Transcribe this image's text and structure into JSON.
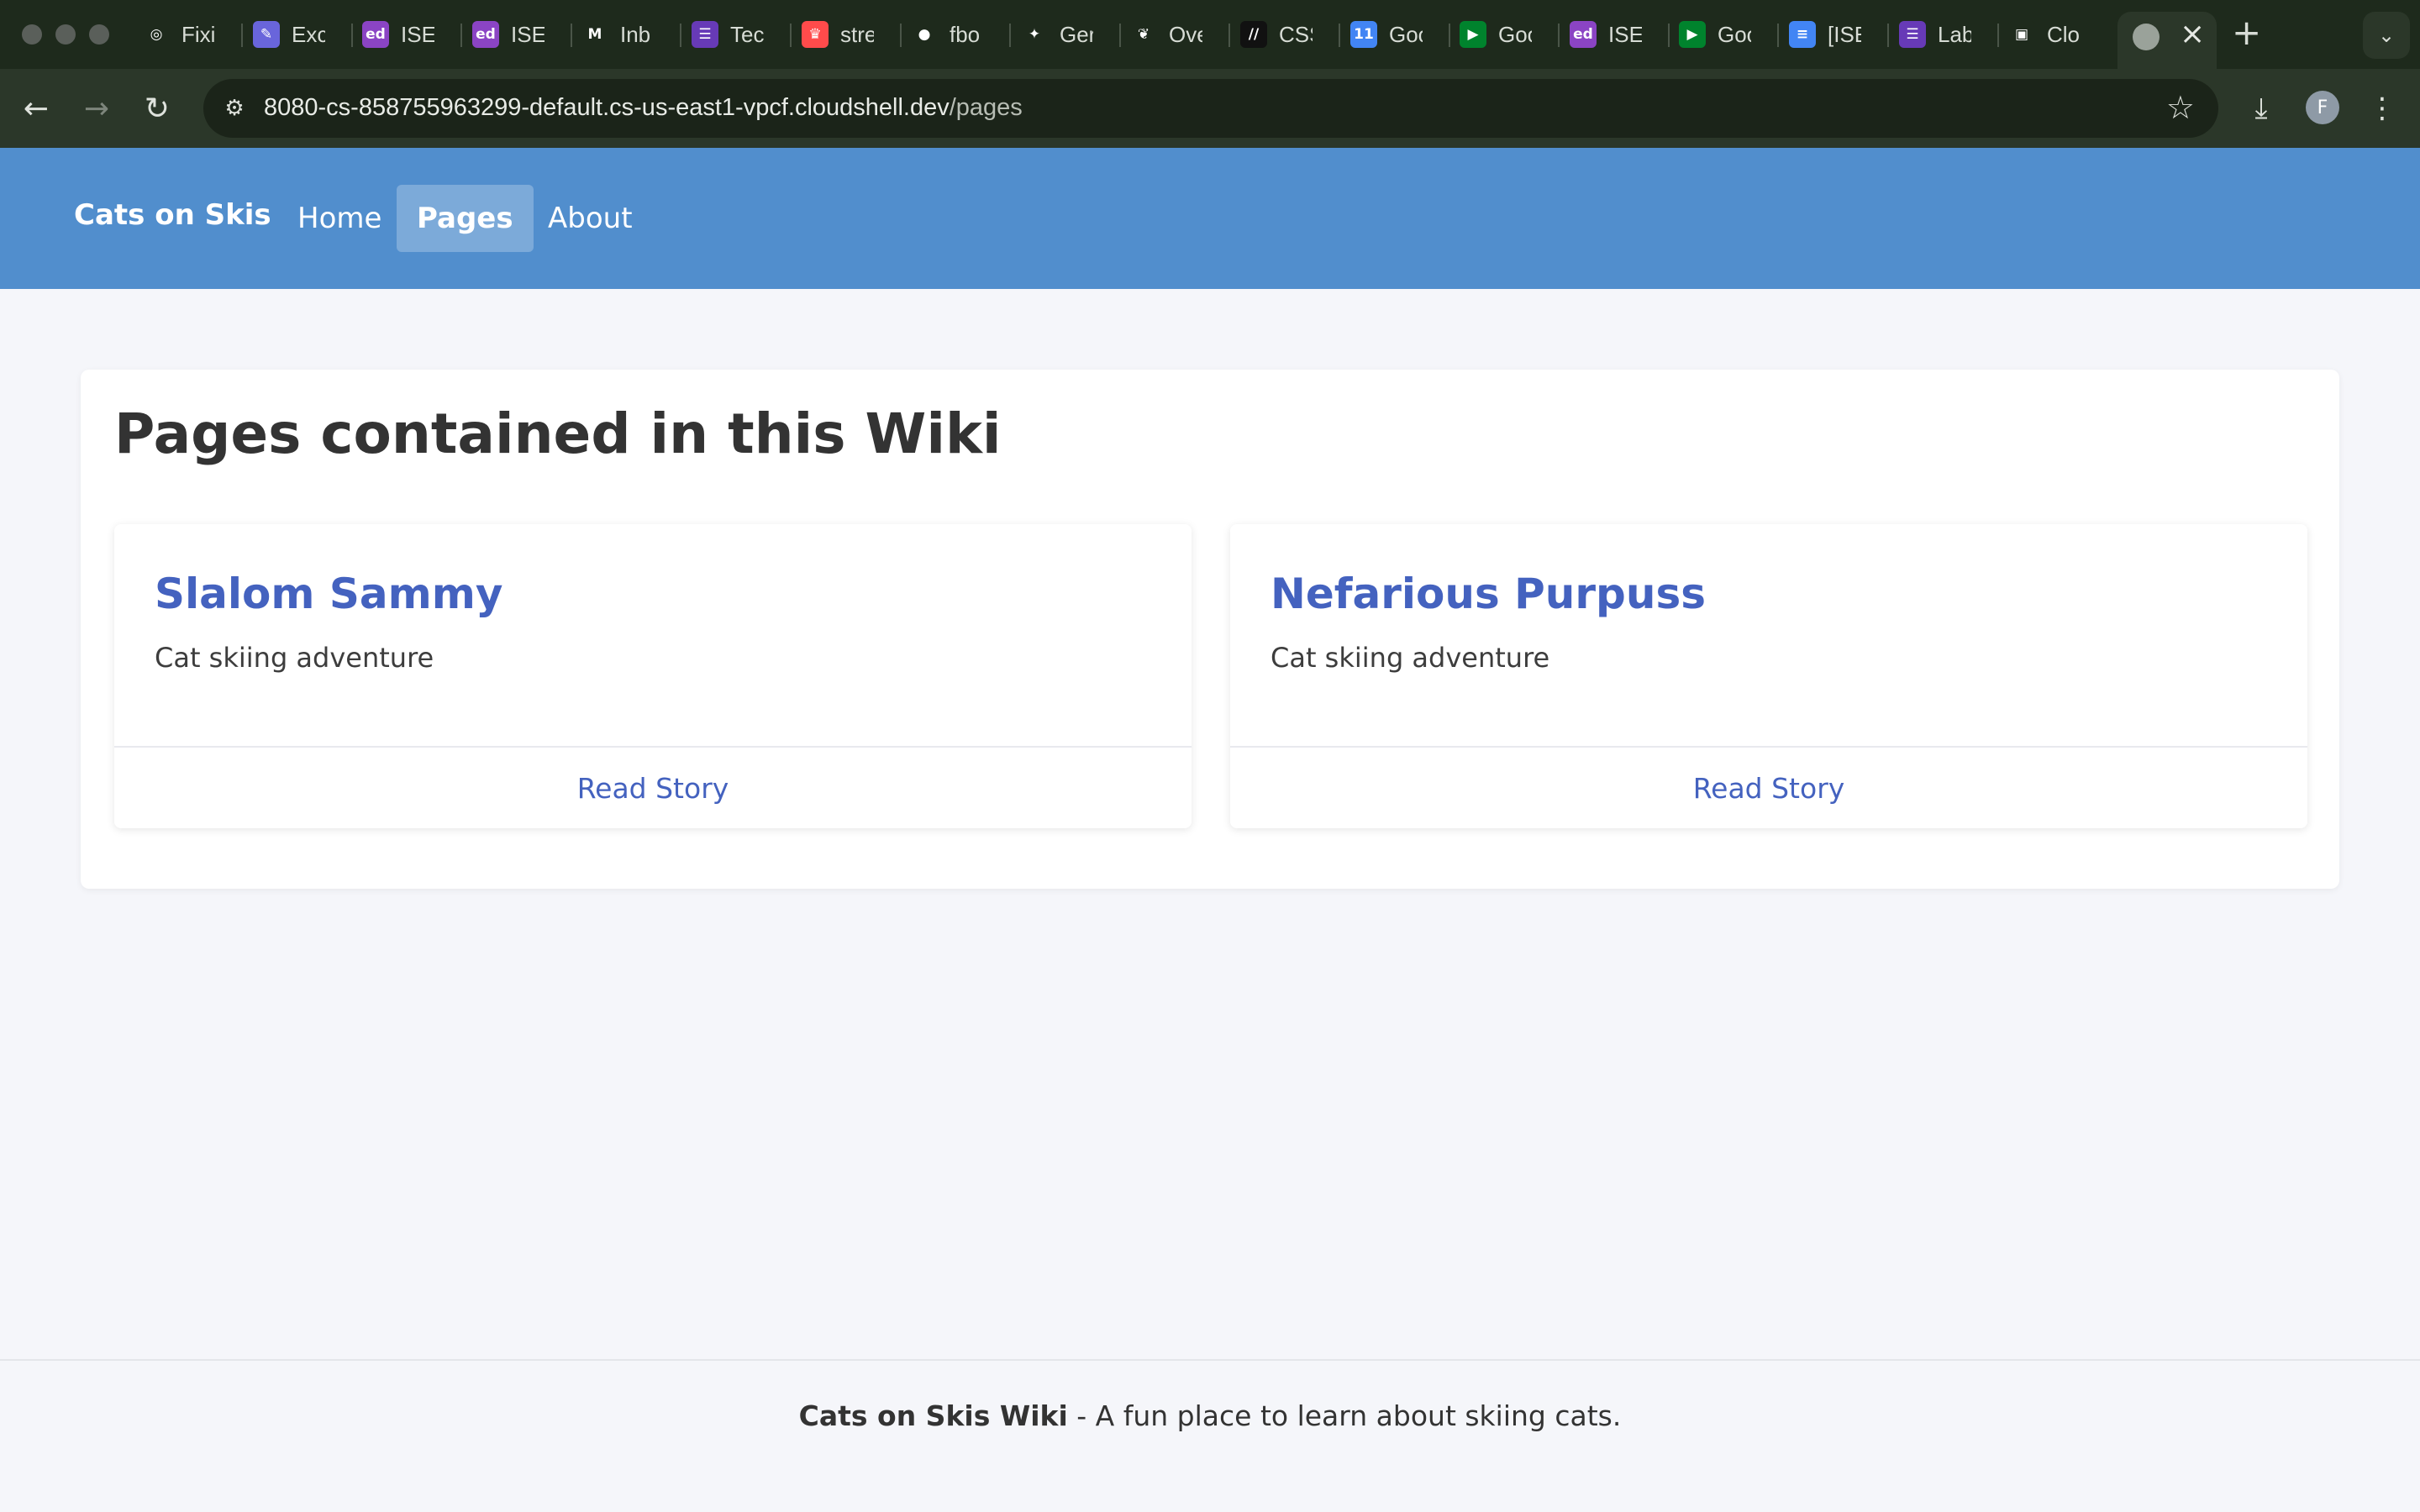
{
  "browser": {
    "tabs": [
      {
        "label": "Fixi",
        "icon": "openai-icon",
        "color": "#1e2a1c",
        "glyph": "◎"
      },
      {
        "label": "Exc",
        "icon": "excalidraw-icon",
        "color": "#6965db",
        "glyph": "✎"
      },
      {
        "label": "ISE",
        "icon": "ed-icon",
        "color": "#8b44c4",
        "glyph": "ed"
      },
      {
        "label": "ISE",
        "icon": "ed-icon",
        "color": "#8b44c4",
        "glyph": "ed"
      },
      {
        "label": "Inb",
        "icon": "gmail-icon",
        "color": "#1e2a1c",
        "glyph": "M"
      },
      {
        "label": "Tec",
        "icon": "forms-icon",
        "color": "#673ab7",
        "glyph": "☰"
      },
      {
        "label": "stre",
        "icon": "streamlit-icon",
        "color": "#ff4b4b",
        "glyph": "♛"
      },
      {
        "label": "fbo",
        "icon": "github-icon",
        "color": "#1e2a1c",
        "glyph": "●"
      },
      {
        "label": "Ger",
        "icon": "gemini-icon",
        "color": "#1e2a1c",
        "glyph": "✦"
      },
      {
        "label": "Ove",
        "icon": "leaf-icon",
        "color": "#1e2a1c",
        "glyph": "❦"
      },
      {
        "label": "CSS",
        "icon": "css-icon",
        "color": "#111111",
        "glyph": "//"
      },
      {
        "label": "Goo",
        "icon": "calendar-icon",
        "color": "#4285f4",
        "glyph": "11"
      },
      {
        "label": "Goo",
        "icon": "meet-icon",
        "color": "#00832d",
        "glyph": "▶"
      },
      {
        "label": "ISE",
        "icon": "ed-icon",
        "color": "#8b44c4",
        "glyph": "ed"
      },
      {
        "label": "Goo",
        "icon": "meet-icon",
        "color": "#00832d",
        "glyph": "▶"
      },
      {
        "label": "[ISE",
        "icon": "docs-icon",
        "color": "#4285f4",
        "glyph": "≡"
      },
      {
        "label": "Lab",
        "icon": "forms-icon",
        "color": "#673ab7",
        "glyph": "☰"
      },
      {
        "label": "Clo",
        "icon": "cloudshell-icon",
        "color": "#1e2a1c",
        "glyph": "▣"
      }
    ],
    "active_tab_icon": "globe-icon",
    "url_host": "8080-cs-858755963299-default.cs-us-east1-vpcf.cloudshell.dev",
    "url_path": "/pages",
    "profile_initial": "F"
  },
  "site": {
    "brand": "Cats on Skis",
    "nav": [
      {
        "label": "Home",
        "active": false
      },
      {
        "label": "Pages",
        "active": true
      },
      {
        "label": "About",
        "active": false
      }
    ],
    "accent": "#518ecd",
    "link_color": "#4462bf"
  },
  "main": {
    "title": "Pages contained in this Wiki",
    "cards": [
      {
        "title": "Slalom Sammy",
        "description": "Cat skiing adventure",
        "action": "Read Story"
      },
      {
        "title": "Nefarious Purpuss",
        "description": "Cat skiing adventure",
        "action": "Read Story"
      }
    ]
  },
  "footer": {
    "name": "Cats on Skis Wiki",
    "tagline": " - A fun place to learn about skiing cats."
  }
}
